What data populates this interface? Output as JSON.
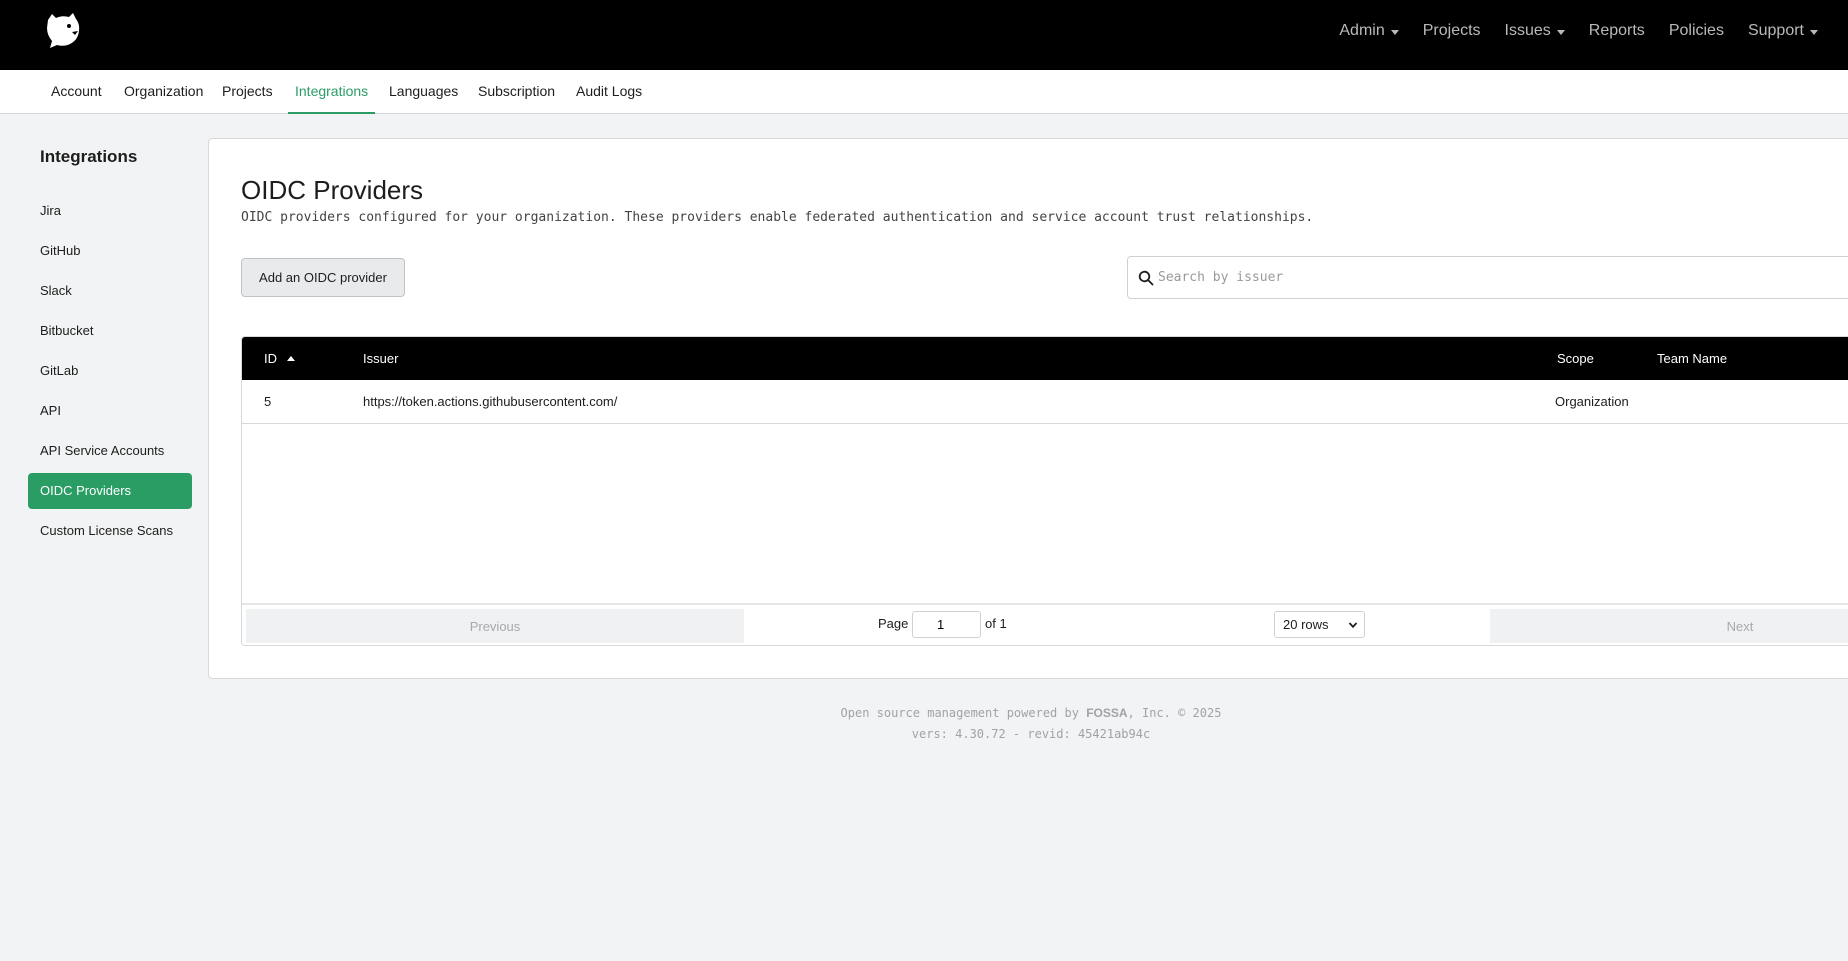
{
  "topnav": {
    "items": [
      {
        "label": "Admin",
        "dropdown": true
      },
      {
        "label": "Projects",
        "dropdown": false
      },
      {
        "label": "Issues",
        "dropdown": true
      },
      {
        "label": "Reports",
        "dropdown": false
      },
      {
        "label": "Policies",
        "dropdown": false
      },
      {
        "label": "Support",
        "dropdown": true
      }
    ]
  },
  "subnav": {
    "tabs": [
      "Account",
      "Organization",
      "Projects",
      "Integrations",
      "Languages",
      "Subscription",
      "Audit Logs"
    ],
    "active": "Integrations"
  },
  "sidebar": {
    "title": "Integrations",
    "items": [
      "Jira",
      "GitHub",
      "Slack",
      "Bitbucket",
      "GitLab",
      "API",
      "API Service Accounts",
      "OIDC Providers",
      "Custom License Scans"
    ],
    "active": "OIDC Providers"
  },
  "main": {
    "title": "OIDC Providers",
    "description": "OIDC providers configured for your organization. These providers enable federated authentication and service account trust relationships.",
    "add_button": "Add an OIDC provider",
    "search_placeholder": "Search by issuer"
  },
  "table": {
    "columns": [
      "ID",
      "Issuer",
      "Scope",
      "Team Name"
    ],
    "rows": [
      {
        "id": "5",
        "issuer": "https://token.actions.githubusercontent.com/",
        "scope": "Organization",
        "team": ""
      }
    ]
  },
  "pagination": {
    "previous": "Previous",
    "next": "Next",
    "page_label": "Page",
    "page_value": "1",
    "of_label": "of 1",
    "rows_option": "20 rows"
  },
  "footer": {
    "line1_pre": "Open source management powered by",
    "brand": "FOSSA",
    "line1_post": ", Inc. © 2025",
    "line2": "vers: 4.30.72 - revid: 45421ab94c"
  },
  "colors": {
    "accent": "#2a9d64",
    "topbar": "#000000"
  }
}
